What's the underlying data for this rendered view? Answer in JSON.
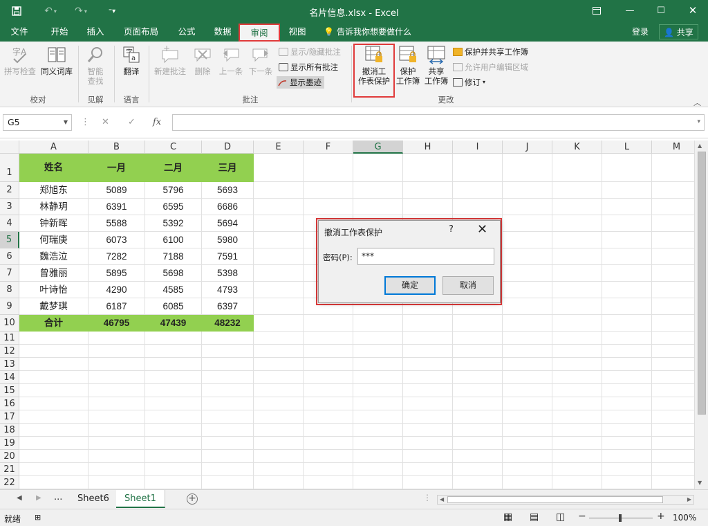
{
  "window": {
    "title": "名片信息.xlsx - Excel",
    "share_label": "共享",
    "login_label": "登录"
  },
  "tabs": [
    "文件",
    "开始",
    "插入",
    "页面布局",
    "公式",
    "数据",
    "审阅",
    "视图"
  ],
  "active_tab": "审阅",
  "tell_me": "告诉我你想要做什么",
  "ribbon": {
    "proofing": {
      "spell": "拼写检查",
      "thesaurus": "同义词库",
      "label": "校对"
    },
    "insights": {
      "smart_lookup_1": "智能",
      "smart_lookup_2": "查找",
      "label": "见解"
    },
    "language": {
      "translate": "翻译",
      "label": "语言"
    },
    "comments": {
      "new": "新建批注",
      "delete": "删除",
      "prev": "上一条",
      "next": "下一条",
      "show_hide": "显示/隐藏批注",
      "show_all": "显示所有批注",
      "show_ink": "显示墨迹",
      "label": "批注"
    },
    "changes": {
      "unprotect_1": "撤消工",
      "unprotect_2": "作表保护",
      "protect_wb_1": "保护",
      "protect_wb_2": "工作簿",
      "share_wb_1": "共享",
      "share_wb_2": "工作簿",
      "protect_share": "保护并共享工作簿",
      "allow_edit": "允许用户编辑区域",
      "track": "修订",
      "label": "更改"
    }
  },
  "formula_bar": {
    "name_box": "G5",
    "fx": "fx",
    "content": ""
  },
  "columns": [
    "A",
    "B",
    "C",
    "D",
    "E",
    "F",
    "G",
    "H",
    "I",
    "J",
    "K",
    "L",
    "M"
  ],
  "selected_column": "G",
  "selected_row": "5",
  "rows": [
    "1",
    "2",
    "3",
    "4",
    "5",
    "6",
    "7",
    "8",
    "9",
    "10",
    "11",
    "12",
    "13",
    "14",
    "15",
    "16",
    "17",
    "18",
    "19",
    "20",
    "21",
    "22"
  ],
  "table": {
    "header": [
      "姓名",
      "一月",
      "二月",
      "三月"
    ],
    "body": [
      [
        "郑旭东",
        "5089",
        "5796",
        "5693"
      ],
      [
        "林静玥",
        "6391",
        "6595",
        "6686"
      ],
      [
        "钟新晖",
        "5588",
        "5392",
        "5694"
      ],
      [
        "何瑞庚",
        "6073",
        "6100",
        "5980"
      ],
      [
        "魏浩泣",
        "7282",
        "7188",
        "7591"
      ],
      [
        "曾雅丽",
        "5895",
        "5698",
        "5398"
      ],
      [
        "叶诗怡",
        "4290",
        "4585",
        "4793"
      ],
      [
        "戴梦琪",
        "6187",
        "6085",
        "6397"
      ]
    ],
    "total": [
      "合计",
      "46795",
      "47439",
      "48232"
    ]
  },
  "sheets": {
    "ellipsis": "...",
    "tabs": [
      "Sheet6",
      "Sheet1"
    ],
    "active": "Sheet1"
  },
  "status": {
    "ready": "就绪",
    "zoom": "100%"
  },
  "dialog": {
    "title": "撤消工作表保护",
    "help": "?",
    "password_label": "密码(P):",
    "password_value": "***",
    "ok": "确定",
    "cancel": "取消"
  },
  "colors": {
    "excel_green": "#217346",
    "highlight_green": "#92d050",
    "annotation_red": "#e03a3a"
  }
}
